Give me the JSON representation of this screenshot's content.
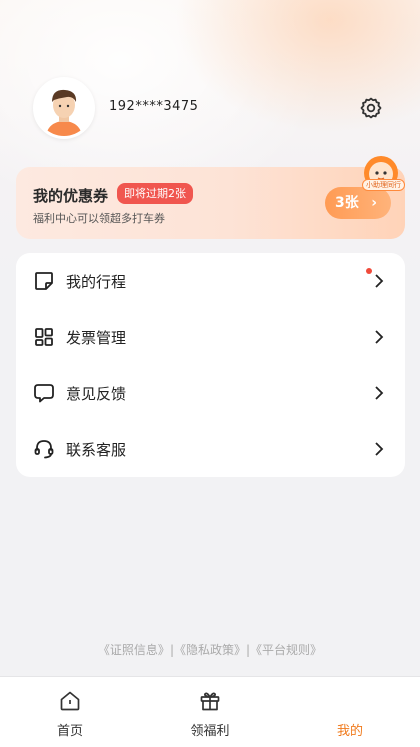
{
  "profile": {
    "phone": "192****3475",
    "avatar_icon": "user-avatar-icon",
    "settings_icon": "gear-icon"
  },
  "coupon": {
    "title": "我的优惠券",
    "badge": "即将过期2张",
    "subtitle": "福利中心可以领超多打车券",
    "count": "3张",
    "arrow": "›",
    "mascot_tag": "小助理同行"
  },
  "menu": {
    "items": [
      {
        "label": "我的行程",
        "icon": "note-icon",
        "has_dot": true
      },
      {
        "label": "发票管理",
        "icon": "grid-icon",
        "has_dot": false
      },
      {
        "label": "意见反馈",
        "icon": "chat-bubble-icon",
        "has_dot": false
      },
      {
        "label": "联系客服",
        "icon": "headset-icon",
        "has_dot": false
      }
    ]
  },
  "footer": {
    "link1": "《证照信息》",
    "sep1": "|",
    "link2": "《隐私政策》",
    "sep2": "|",
    "link3": "《平台规则》"
  },
  "tabbar": {
    "tabs": [
      {
        "label": "首页",
        "icon": "home-icon",
        "active": false
      },
      {
        "label": "领福利",
        "icon": "gift-icon",
        "active": false
      },
      {
        "label": "我的",
        "icon": "",
        "active": true
      }
    ]
  },
  "colors": {
    "accent": "#f07a1c",
    "badge": "#f0564f",
    "dot": "#f04a3a"
  }
}
